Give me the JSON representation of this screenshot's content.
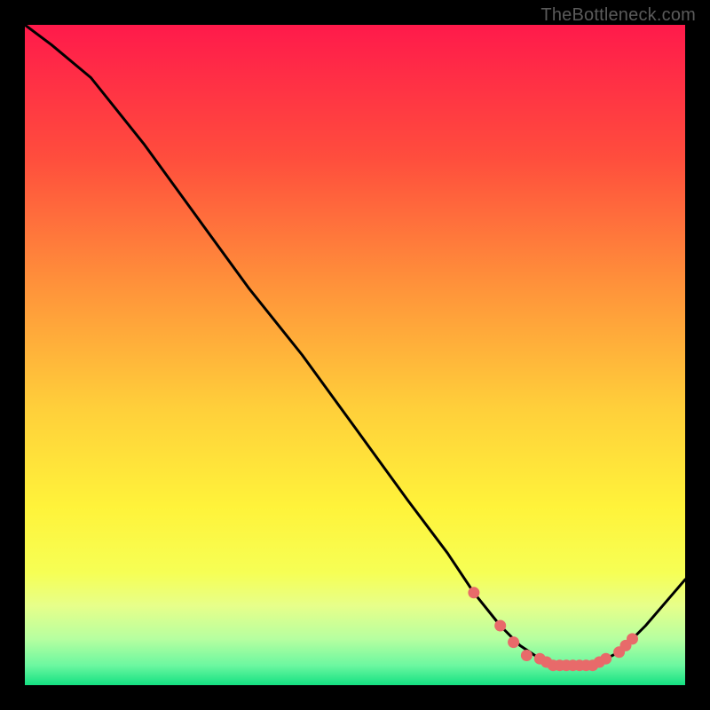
{
  "watermark": "TheBottleneck.com",
  "colors": {
    "page_bg": "#000000",
    "curve": "#000000",
    "marker": "#e86a6a",
    "gradient_stops": [
      {
        "offset": 0.0,
        "color": "#ff1a4b"
      },
      {
        "offset": 0.2,
        "color": "#ff4d3d"
      },
      {
        "offset": 0.4,
        "color": "#ff943a"
      },
      {
        "offset": 0.58,
        "color": "#ffcf3a"
      },
      {
        "offset": 0.73,
        "color": "#fff33a"
      },
      {
        "offset": 0.83,
        "color": "#f6ff55"
      },
      {
        "offset": 0.88,
        "color": "#e7ff8a"
      },
      {
        "offset": 0.93,
        "color": "#b6ffa0"
      },
      {
        "offset": 0.97,
        "color": "#6cf7a0"
      },
      {
        "offset": 1.0,
        "color": "#14e082"
      }
    ]
  },
  "chart_data": {
    "type": "line",
    "xlabel": "",
    "ylabel": "",
    "title": "",
    "xlim": [
      0,
      100
    ],
    "ylim": [
      0,
      100
    ],
    "series": [
      {
        "name": "bottleneck_curve",
        "x": [
          0,
          4,
          10,
          18,
          26,
          34,
          42,
          50,
          58,
          64,
          68,
          72,
          75,
          78,
          80,
          82,
          84,
          86,
          88,
          90,
          94,
          100
        ],
        "values": [
          100,
          97,
          92,
          82,
          71,
          60,
          50,
          39,
          28,
          20,
          14,
          9,
          6,
          4,
          3,
          3,
          3,
          3,
          4,
          5,
          9,
          16
        ]
      }
    ],
    "markers": [
      {
        "x": 68,
        "y": 14
      },
      {
        "x": 72,
        "y": 9
      },
      {
        "x": 74,
        "y": 6.5
      },
      {
        "x": 76,
        "y": 4.5
      },
      {
        "x": 78,
        "y": 4
      },
      {
        "x": 79,
        "y": 3.5
      },
      {
        "x": 80,
        "y": 3
      },
      {
        "x": 81,
        "y": 3
      },
      {
        "x": 82,
        "y": 3
      },
      {
        "x": 83,
        "y": 3
      },
      {
        "x": 84,
        "y": 3
      },
      {
        "x": 85,
        "y": 3
      },
      {
        "x": 86,
        "y": 3
      },
      {
        "x": 87,
        "y": 3.5
      },
      {
        "x": 88,
        "y": 4
      },
      {
        "x": 90,
        "y": 5
      },
      {
        "x": 91,
        "y": 6
      },
      {
        "x": 92,
        "y": 7
      }
    ]
  }
}
